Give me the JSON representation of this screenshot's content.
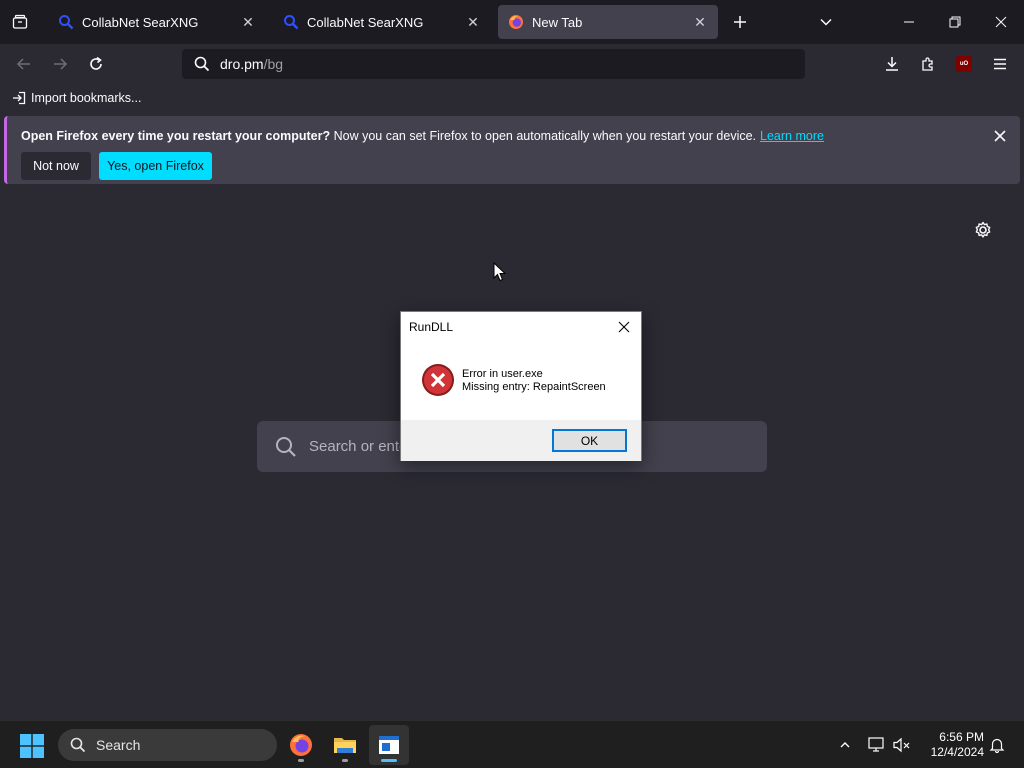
{
  "browser": {
    "tabs": [
      {
        "title": "CollabNet SearXNG",
        "active": false
      },
      {
        "title": "CollabNet SearXNG",
        "active": false
      },
      {
        "title": "New Tab",
        "active": true
      }
    ],
    "url_host": "dro.pm",
    "url_path": "/bg",
    "ublock_label": "uO",
    "bookmarks_import_label": "Import bookmarks..."
  },
  "notification": {
    "bold_text": "Open Firefox every time you restart your computer?",
    "text": " Now you can set Firefox to open automatically when you restart your device.",
    "link": "Learn more",
    "not_now": "Not now",
    "yes": "Yes, open Firefox"
  },
  "newtab": {
    "search_placeholder": "Search or ente"
  },
  "dialog": {
    "title": "RunDLL",
    "line1": "Error in user.exe",
    "line2": "Missing entry: RepaintScreen",
    "ok": "OK"
  },
  "taskbar": {
    "search_label": "Search",
    "time": "6:56 PM",
    "date": "12/4/2024"
  },
  "colors": {
    "accent": "#00ddff",
    "tab_active": "#42414d",
    "error_red": "#d13438"
  }
}
